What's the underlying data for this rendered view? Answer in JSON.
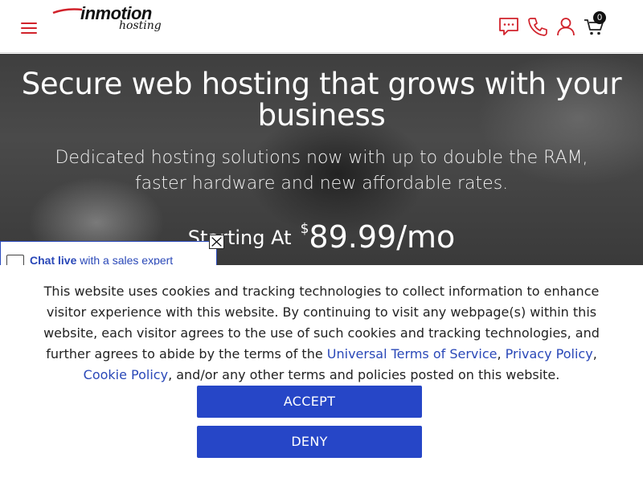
{
  "header": {
    "logo_main": "inmotion",
    "logo_sub": "hosting",
    "cart_count": "0",
    "icons": [
      "menu-icon",
      "chat-icon",
      "phone-icon",
      "user-icon",
      "cart-icon"
    ],
    "accent_color": "#d1222b"
  },
  "hero": {
    "title": "Secure web hosting that grows with your business",
    "subtitle": "Dedicated hosting solutions now with up to double the RAM, faster hardware and new affordable rates.",
    "starting_label": "Starting At",
    "currency": "$",
    "price": "89.99/mo"
  },
  "chat": {
    "bold": "Chat live",
    "rest": "with a sales expert"
  },
  "cookie": {
    "text_1": "This website uses cookies and tracking technologies to collect information to enhance visitor experience with this website. By continuing to visit any webpage(s) within this website, each visitor agrees to the use of such cookies and tracking technologies, and further agrees to abide by the terms of the ",
    "link_terms": "Universal Terms of Service",
    "sep_1": ", ",
    "link_privacy": "Privacy Policy",
    "sep_2": ", ",
    "link_cookie": "Cookie Policy",
    "text_2": ", and/or any other terms and policies posted on this website.",
    "accept_label": "ACCEPT",
    "deny_label": "DENY",
    "button_color": "#2646c7",
    "link_color": "#2a48b8"
  }
}
